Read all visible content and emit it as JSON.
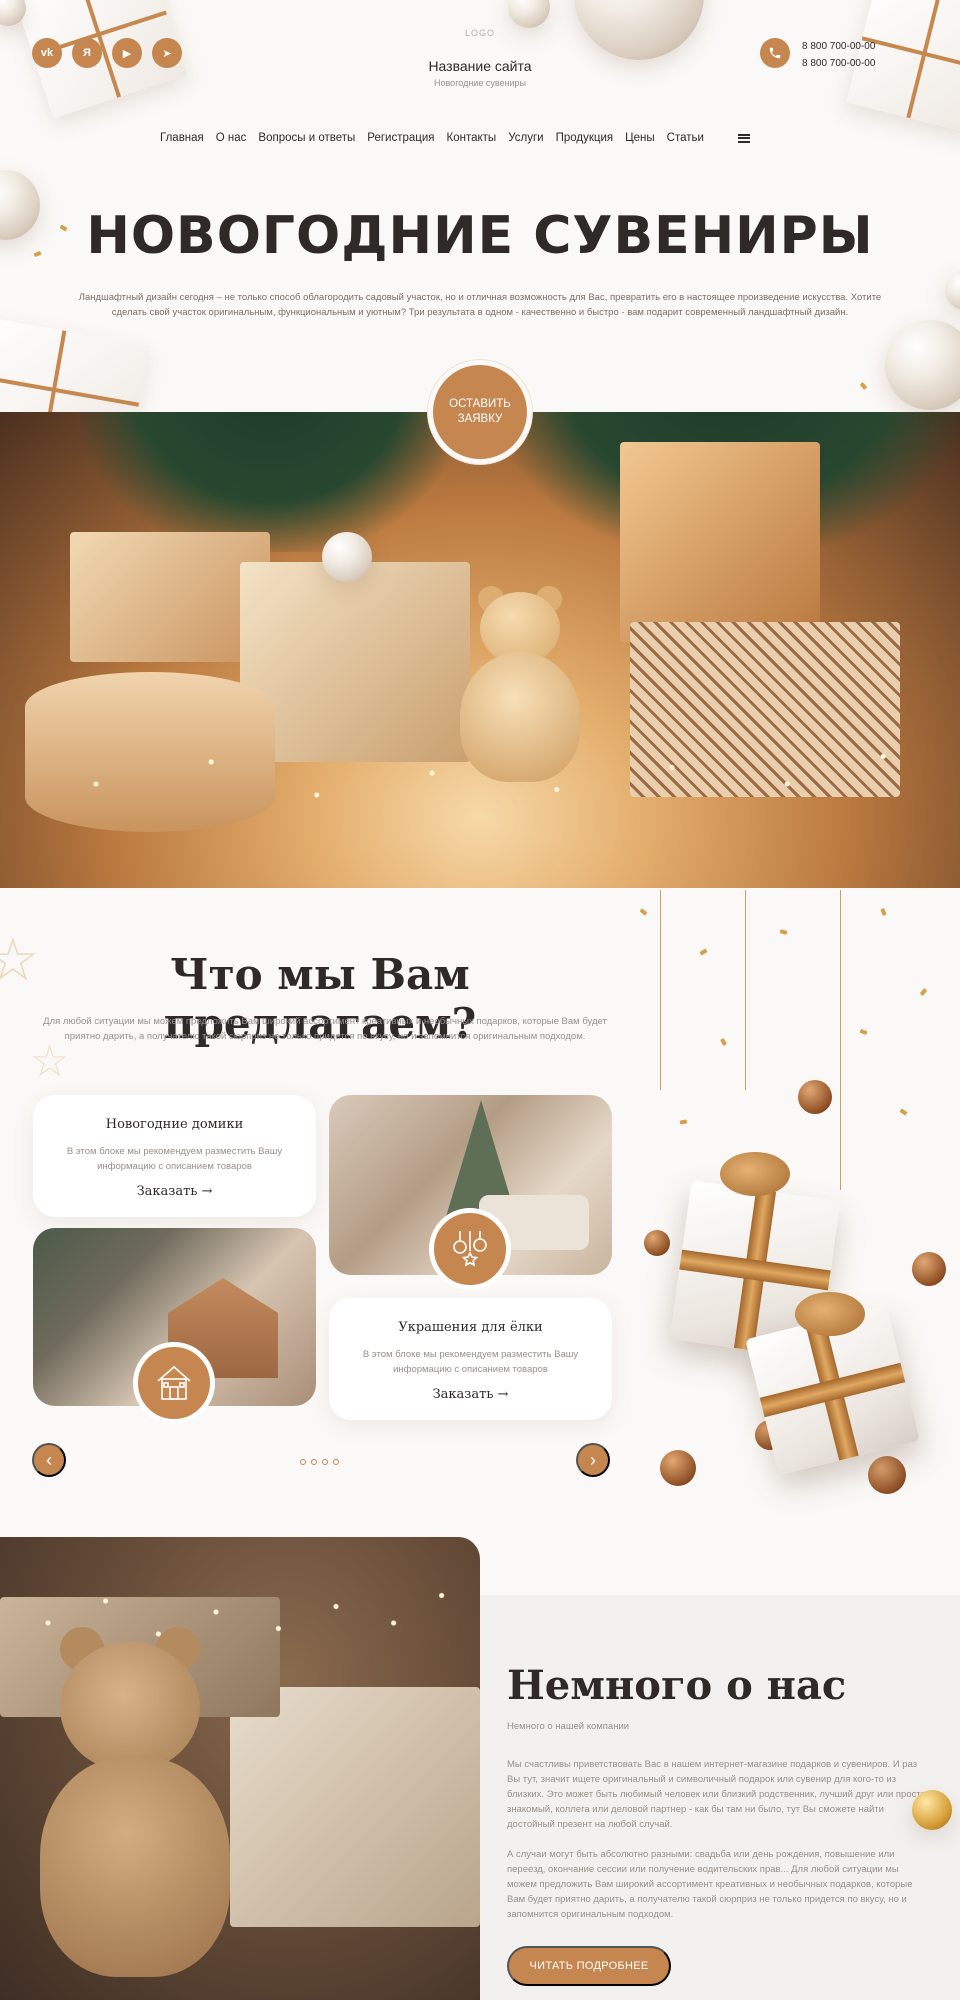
{
  "header": {
    "socials": [
      {
        "icon": "vk-icon",
        "glyph": "vk"
      },
      {
        "icon": "yandex-icon",
        "glyph": "Я"
      },
      {
        "icon": "youtube-icon",
        "glyph": "▶"
      },
      {
        "icon": "telegram-icon",
        "glyph": "➤"
      }
    ],
    "logo": "LOGO",
    "site_name": "Название сайта",
    "site_subtitle": "Новогодние сувениры",
    "phones": [
      "8 800 700-00-00",
      "8 800 700-00-00"
    ]
  },
  "nav": {
    "items": [
      "Главная",
      "О нас",
      "Вопросы и ответы",
      "Регистрация",
      "Контакты",
      "Услуги",
      "Продукция",
      "Цены",
      "Статьи"
    ]
  },
  "hero": {
    "title": "НОВОГОДНИЕ СУВЕНИРЫ",
    "text": "Ландшафтный дизайн сегодня – не только способ облагородить садовый участок, но и отличная возможность для Вас, превратить его в настоящее произведение искусства. Хотите сделать свой участок оригинальным, функциональным и уютным? Три результата в  одном - качественно и быстро - вам подарит современный ландшафтный дизайн.",
    "cta_label": "ОСТАВИТЬ ЗАЯВКУ"
  },
  "offers": {
    "title": "Что мы Вам предлагаем?",
    "text": "Для любой ситуации мы можем предложить Вам широкий ассортимент креативных и необычных подарков, которые Вам будет приятно дарить, а получателю такой сюрприз не только придется по вкусу, но и запомнится оригинальным подходом.",
    "cards": [
      {
        "title": "Новогодние домики",
        "text": "В этом блоке мы рекомендуем разместить Вашу информацию с описанием товаров",
        "link": "Заказать →"
      },
      {
        "title": "Украшения для ёлки",
        "text": "В этом блоке мы рекомендуем разместить Вашу информацию с описанием товаров",
        "link": "Заказать →"
      }
    ],
    "prev_glyph": "‹",
    "next_glyph": "›"
  },
  "about": {
    "title": "Немного о нас",
    "subtitle": "Немного о нашей компании",
    "p1": "Мы счастливы приветствовать Вас в нашем интернет-магазине подарков и сувениров. И раз Вы тут, значит ищете оригинальный и символичный подарок или сувенир для кого-то из близких. Это может быть любимый человек или близкий родственник, лучший друг или просто знакомый, коллега или деловой партнер - как бы там ни было, тут Вы сможете найти достойный презент на любой случай.",
    "p2": "А случаи могут быть абсолютно разными: свадьба или день рождения, повышение или переезд, окончание сессии или получение водительских прав... Для любой ситуации мы можем предложить Вам широкий ассортимент креативных и необычных подарков, которые Вам будет приятно дарить, а получателю такой сюрприз не только придется по вкусу, но и запомнится оригинальным подходом.",
    "button_label": "ЧИТАТЬ ПОДРОБНЕЕ"
  },
  "colors": {
    "accent": "#c58650",
    "text": "#2f2a28",
    "muted": "#9a908a",
    "background": "#fbf9f7"
  }
}
